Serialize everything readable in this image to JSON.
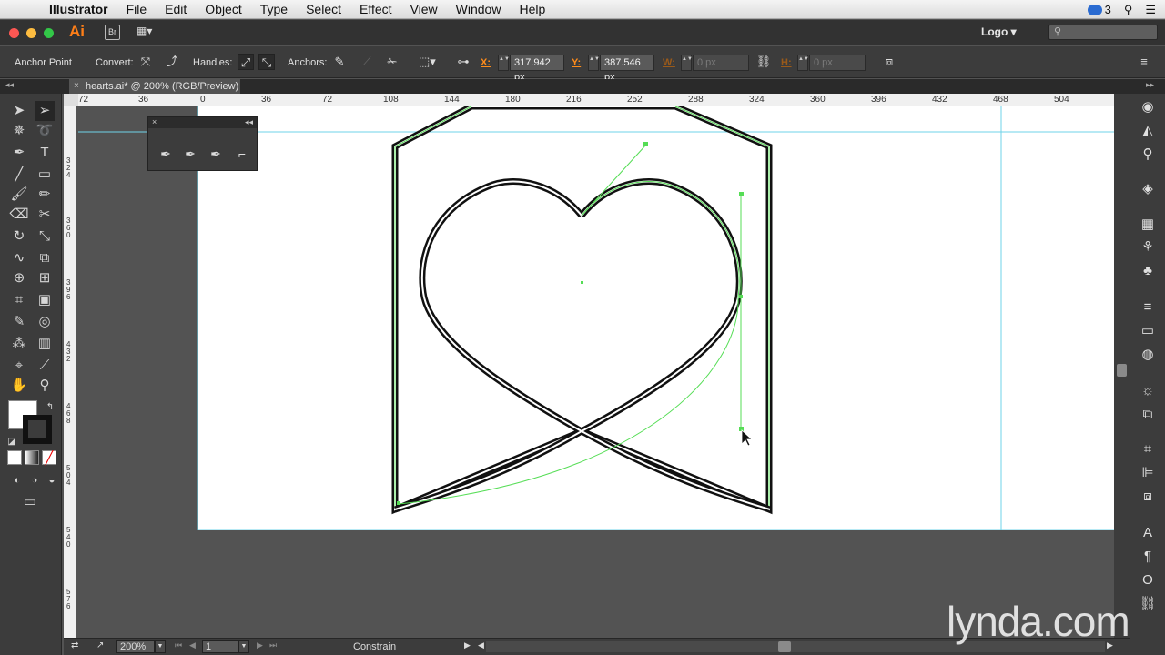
{
  "menubar": {
    "app_name": "Illustrator",
    "items": [
      "File",
      "Edit",
      "Object",
      "Type",
      "Select",
      "Effect",
      "View",
      "Window",
      "Help"
    ],
    "cc_count": "3"
  },
  "appbar": {
    "ai_label": "Ai",
    "bridge_label": "Br",
    "workspace": "Logo",
    "workspace_arrow": "▾",
    "search_placeholder": ""
  },
  "control": {
    "tool_name": "Anchor Point",
    "convert_label": "Convert:",
    "handles_label": "Handles:",
    "anchors_label": "Anchors:",
    "x_label": "X:",
    "x_value": "317.942 px",
    "y_label": "Y:",
    "y_value": "387.546 px",
    "w_label": "W:",
    "w_value": "0 px",
    "h_label": "H:",
    "h_value": "0 px"
  },
  "document": {
    "tab_title": "hearts.ai* @ 200% (RGB/Preview)"
  },
  "ruler": {
    "h_ticks": [
      "72",
      "36",
      "0",
      "36",
      "72",
      "108",
      "144",
      "180",
      "216",
      "252",
      "288",
      "324",
      "360",
      "396",
      "432",
      "468",
      "504"
    ],
    "v_ticks": [
      "324",
      "360",
      "396",
      "432",
      "468",
      "504",
      "540",
      "576"
    ]
  },
  "status": {
    "zoom": "200%",
    "page": "1",
    "mode": "Constrain"
  },
  "watermark": "lynda.com",
  "colors": {
    "path_highlight": "#55dd55",
    "guide": "#6fd3e8",
    "accent_orange": "#ff8c1a"
  }
}
